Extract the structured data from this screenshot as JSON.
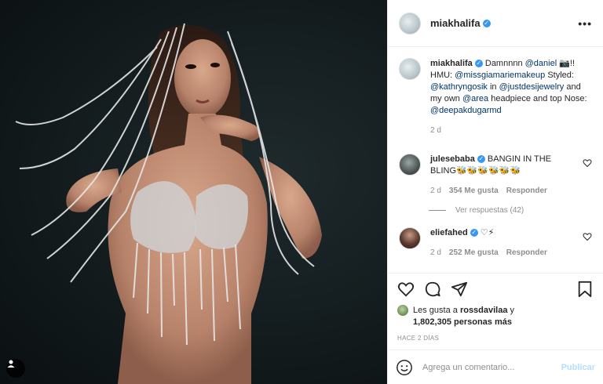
{
  "post": {
    "author": "miakhalifa",
    "caption": {
      "username": "miakhalifa",
      "parts": [
        {
          "text": " Damnnnn "
        },
        {
          "text": "@daniel",
          "mention": true
        },
        {
          "text": " 📷!! HMU: "
        },
        {
          "text": "@missgiamariemakeup",
          "mention": true
        },
        {
          "text": " Styled: "
        },
        {
          "text": "@kathryngosik",
          "mention": true
        },
        {
          "text": " in "
        },
        {
          "text": "@justdesijewelry",
          "mention": true
        },
        {
          "text": " and my own "
        },
        {
          "text": "@area",
          "mention": true
        },
        {
          "text": " headpiece and top Nose: "
        },
        {
          "text": "@deepakdugarmd",
          "mention": true
        }
      ],
      "time": "2 d"
    },
    "comments": [
      {
        "username": "julesebaba",
        "verified": true,
        "text": "BANGIN IN THE BLING🐝🐝🐝🐝🐝🐝",
        "time": "2 d",
        "likes": "354 Me gusta",
        "reply": "Responder",
        "view_replies": "Ver respuestas (42)"
      },
      {
        "username": "eliefahed",
        "verified": true,
        "text": "♡⚡",
        "time": "2 d",
        "likes": "252 Me gusta",
        "reply": "Responder"
      }
    ],
    "likes": {
      "prefix": "Les gusta a ",
      "user": "rossdavilaa",
      "suffix": " y",
      "count": "1,802,305 personas más"
    },
    "posted_ago": "HACE 2 DÍAS",
    "add_comment": {
      "placeholder": "Agrega un comentario...",
      "publish": "Publicar"
    }
  },
  "icons": {
    "more": "more-options-icon",
    "like": "heart-icon",
    "comment": "comment-icon",
    "share": "share-icon",
    "save": "bookmark-icon",
    "emoji": "emoji-icon",
    "user_tag": "user-tag-icon"
  },
  "colors": {
    "verified": "#3897f0",
    "mention": "#003569",
    "muted": "#8e8e8e",
    "publish_disabled": "#b2dffc"
  }
}
